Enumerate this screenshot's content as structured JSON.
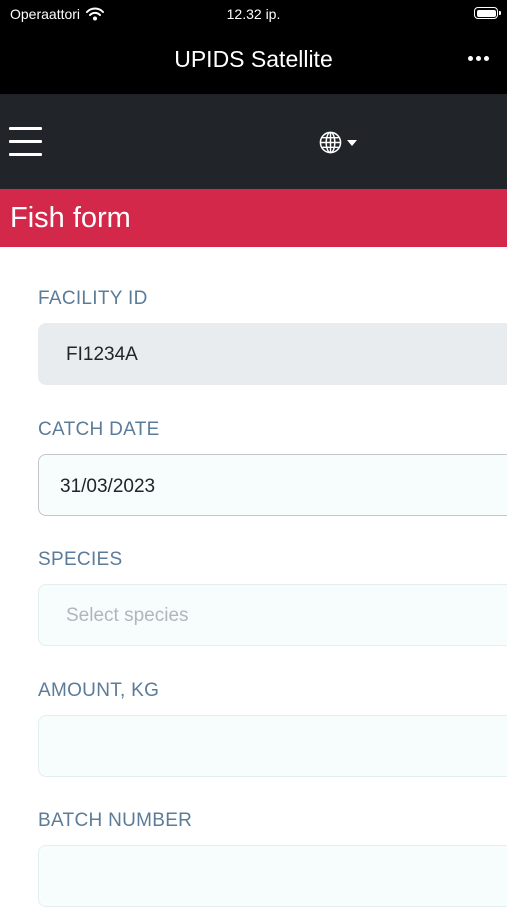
{
  "status_bar": {
    "carrier": "Operaattori",
    "time": "12.32 ip."
  },
  "app": {
    "title": "UPIDS Satellite"
  },
  "navbar": {
    "menu_icon": "hamburger-icon",
    "language_icon": "globe-icon"
  },
  "form": {
    "title": "Fish form",
    "fields": [
      {
        "label": "FACILITY ID",
        "value": "FI1234A",
        "placeholder": "",
        "state": "readonly"
      },
      {
        "label": "CATCH DATE",
        "value": "31/03/2023",
        "placeholder": "",
        "state": "active"
      },
      {
        "label": "SPECIES",
        "value": "",
        "placeholder": "Select species",
        "state": "empty"
      },
      {
        "label": "AMOUNT, KG",
        "value": "",
        "placeholder": "",
        "state": "empty"
      },
      {
        "label": "BATCH NUMBER",
        "value": "",
        "placeholder": "",
        "state": "empty"
      }
    ]
  },
  "colors": {
    "header_red": "#d4284a",
    "navbar_dark": "#212529",
    "label_blue": "#5b7c99",
    "readonly_bg": "#e9ecef"
  }
}
